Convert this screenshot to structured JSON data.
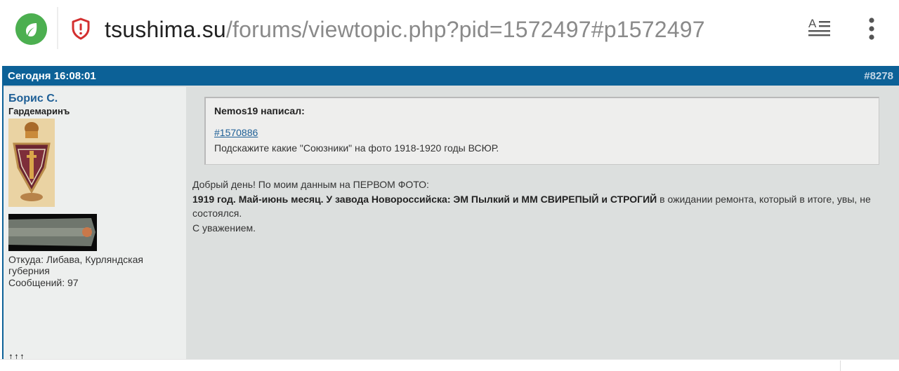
{
  "browser": {
    "url_host": "tsushima.su",
    "url_path": "/forums/viewtopic.php?pid=1572497#p1572497",
    "home_icon": "leaf-icon",
    "security_icon": "shield-alert-icon",
    "reader_icon": "reader-mode-icon",
    "menu_icon": "more-vertical-icon",
    "reader_glyph": "A"
  },
  "post": {
    "date": "Сегодня 16:08:01",
    "number": "#8278",
    "author": {
      "name": "Борис С.",
      "rank": "Гардемаринъ",
      "location": "Откуда: Либава, Курляндская губерния",
      "messages": "Сообщений: 97",
      "arrows": "↑↑↑"
    },
    "quote": {
      "author": "Nemos19 написал:",
      "link": "#1570886",
      "text": "Подскажите какие \"Союзники\" на фото 1918-1920 годы ВСЮР."
    },
    "message": {
      "greeting": "Добрый день! По моим данным на ПЕРВОМ ФОТО:",
      "bold": "1919 год. Май-июнь месяц. У завода Новороссийска: ЭМ Пылкий и ММ СВИРЕПЫЙ и СТРОГИЙ",
      "rest": " в ожидании ремонта, который в итоге, увы, не состоялся.",
      "signoff": "С уважением."
    }
  },
  "colors": {
    "header_blue": "#0c6197",
    "author_link": "#1e5f96",
    "home_green": "#4caf50"
  }
}
